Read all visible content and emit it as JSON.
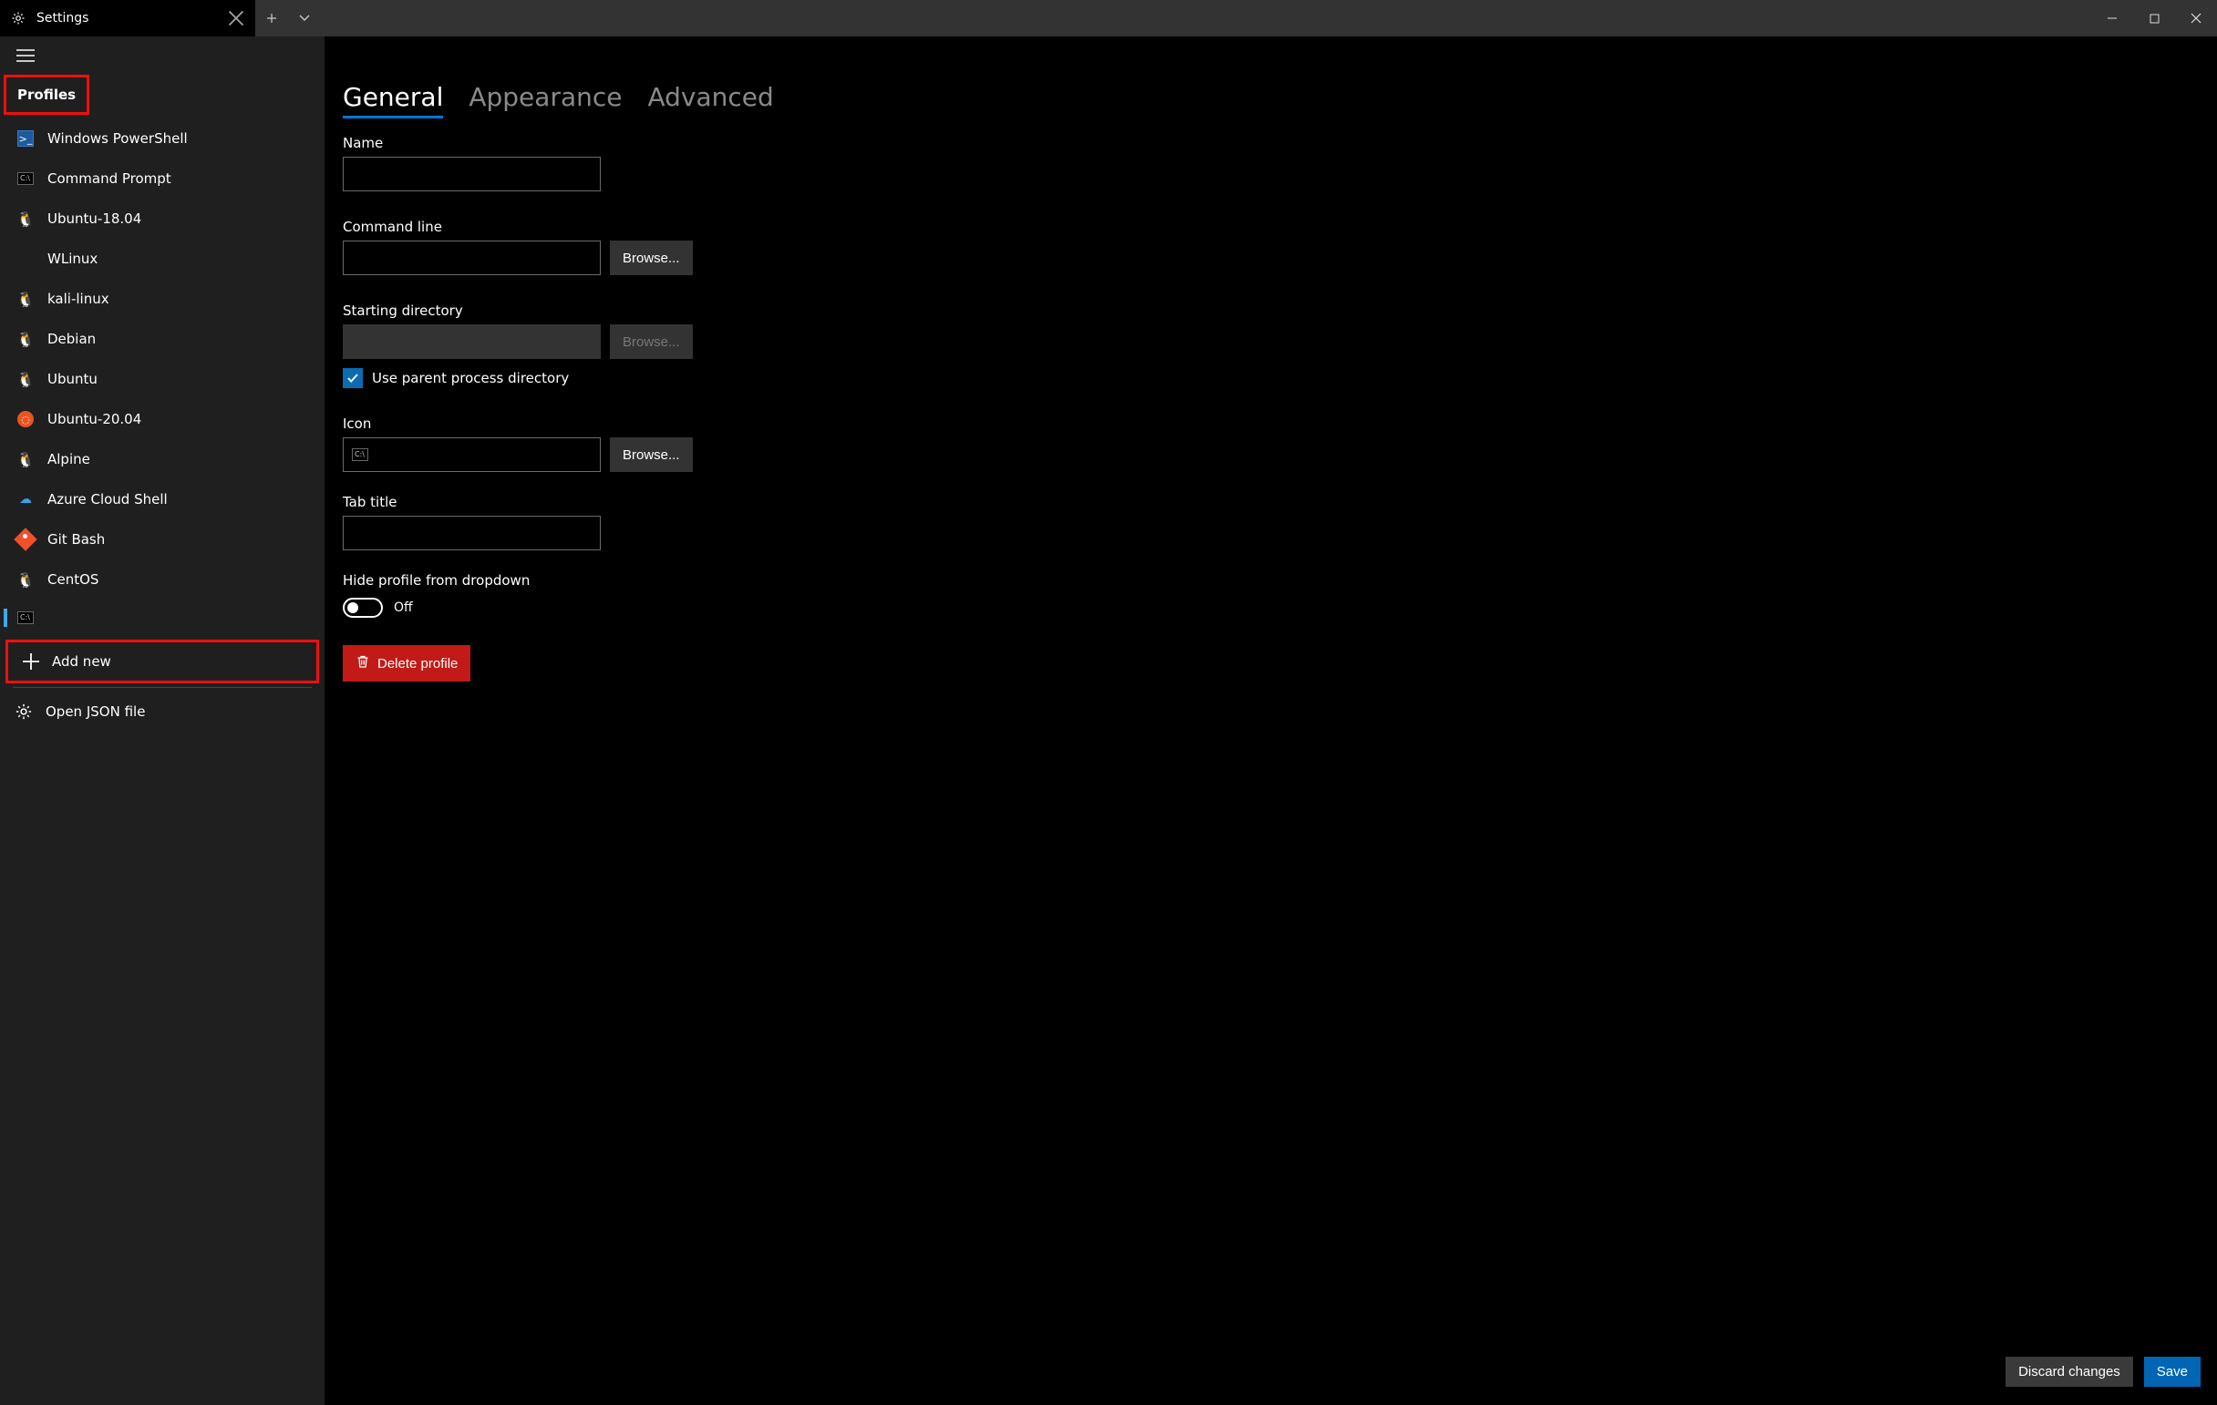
{
  "titlebar": {
    "tab_title": "Settings"
  },
  "sidebar": {
    "section_label": "Profiles",
    "items": [
      {
        "label": "Windows PowerShell",
        "icon": "powershell-icon"
      },
      {
        "label": "Command Prompt",
        "icon": "cmd-icon"
      },
      {
        "label": "Ubuntu-18.04",
        "icon": "tux-icon"
      },
      {
        "label": "WLinux",
        "icon": "blank-icon"
      },
      {
        "label": "kali-linux",
        "icon": "tux-icon"
      },
      {
        "label": "Debian",
        "icon": "tux-icon"
      },
      {
        "label": "Ubuntu",
        "icon": "tux-icon"
      },
      {
        "label": "Ubuntu-20.04",
        "icon": "ubuntu-icon"
      },
      {
        "label": "Alpine",
        "icon": "tux-icon"
      },
      {
        "label": "Azure Cloud Shell",
        "icon": "azure-icon"
      },
      {
        "label": "Git Bash",
        "icon": "git-icon"
      },
      {
        "label": "CentOS",
        "icon": "tux-icon"
      }
    ],
    "selected_blank_icon": "cmd-icon",
    "add_new_label": "Add new",
    "open_json_label": "Open JSON file"
  },
  "tabs": {
    "general": "General",
    "appearance": "Appearance",
    "advanced": "Advanced"
  },
  "fields": {
    "name_label": "Name",
    "name_value": "",
    "cmdline_label": "Command line",
    "cmdline_value": "",
    "cmdline_browse": "Browse...",
    "startdir_label": "Starting directory",
    "startdir_value": "",
    "startdir_browse": "Browse...",
    "use_parent_label": "Use parent process directory",
    "icon_label": "Icon",
    "icon_value": "",
    "icon_browse": "Browse...",
    "tabtitle_label": "Tab title",
    "tabtitle_value": "",
    "hide_label": "Hide profile from dropdown",
    "hide_state": "Off",
    "delete_label": "Delete profile"
  },
  "footer": {
    "discard": "Discard changes",
    "save": "Save"
  }
}
